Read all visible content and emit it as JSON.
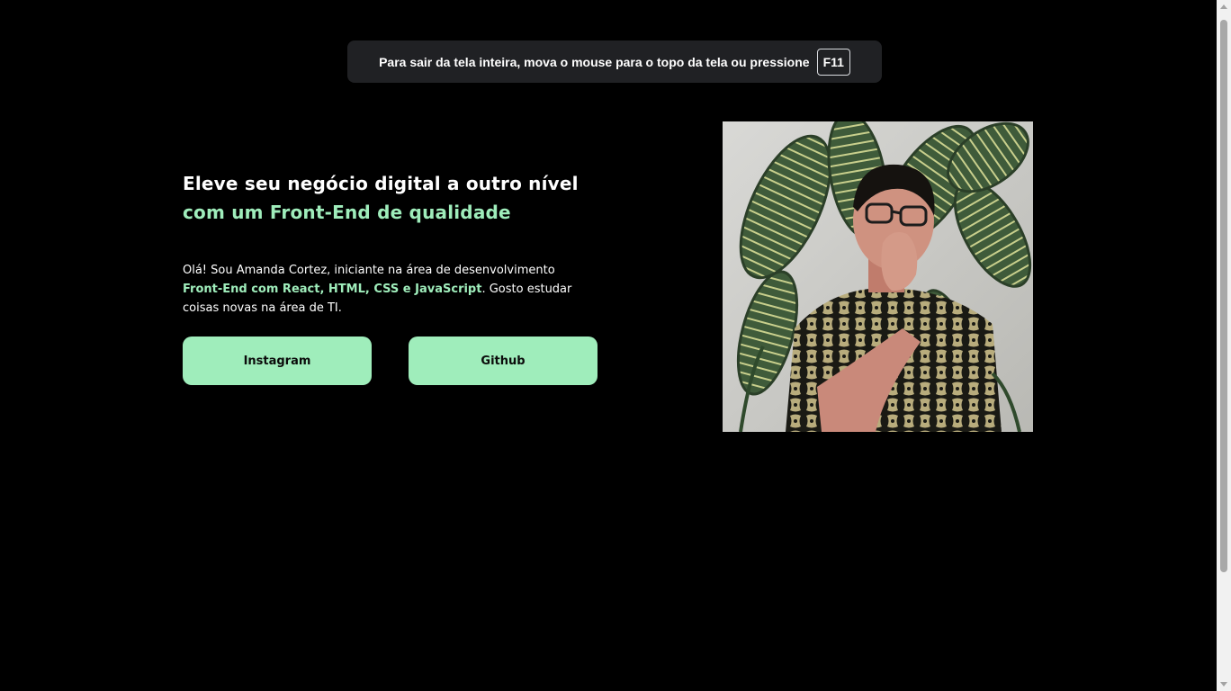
{
  "fullscreen_notice": {
    "message": "Para sair da tela inteira, mova o mouse para o topo da tela ou pressione",
    "key": "F11"
  },
  "hero": {
    "headline_plain": "Eleve seu negócio digital a outro nível ",
    "headline_accent": "com um Front-End de qualidade",
    "intro_before": "Olá! Sou Amanda Cortez, iniciante na área de desenvolvimento ",
    "intro_accent": "Front-End com React, HTML, CSS e JavaScript",
    "intro_after": ". Gosto estudar coisas novas na área de TI."
  },
  "buttons": {
    "instagram": "Instagram",
    "github": "Github"
  },
  "colors": {
    "accent": "#9fedbb",
    "background": "#000000",
    "notice_bg": "#202124"
  },
  "photo": {
    "icon": "profile-photo"
  }
}
